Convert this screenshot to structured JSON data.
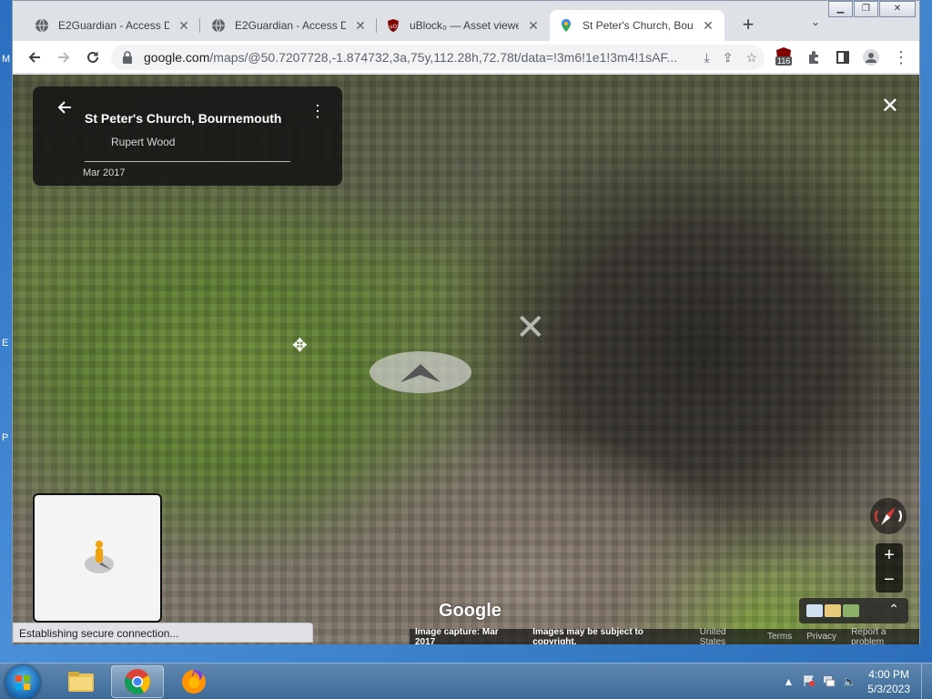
{
  "desktop_edge": [
    "M",
    "E",
    "P"
  ],
  "tabs": [
    {
      "title": "E2Guardian - Access Denied",
      "icon": "globe-icon"
    },
    {
      "title": "E2Guardian - Access Denied",
      "icon": "globe-icon"
    },
    {
      "title": "uBlock₀ — Asset viewer",
      "icon": "ublock-icon"
    },
    {
      "title": "St Peter's Church, Bournemouth",
      "icon": "google-maps-icon"
    }
  ],
  "toolbar": {
    "url_host": "google.com",
    "url_path": "/maps/@50.7207728,-1.874732,3a,75y,112.28h,72.78t/data=!3m6!1e1!3m4!1sAF...",
    "ext_badge": "116"
  },
  "streetview": {
    "place_name": "St Peter's Church, Bournemouth",
    "author": "Rupert Wood",
    "date": "Mar 2017",
    "logo": "Google",
    "footer": {
      "capture": "Image capture: Mar 2017",
      "copyright": "Images may be subject to copyright.",
      "region": "United States",
      "terms": "Terms",
      "privacy": "Privacy",
      "report": "Report a problem"
    },
    "zoom_in": "+",
    "zoom_out": "−"
  },
  "status": "Establishing secure connection...",
  "taskbar": {
    "time": "4:00 PM",
    "date": "5/3/2023"
  }
}
